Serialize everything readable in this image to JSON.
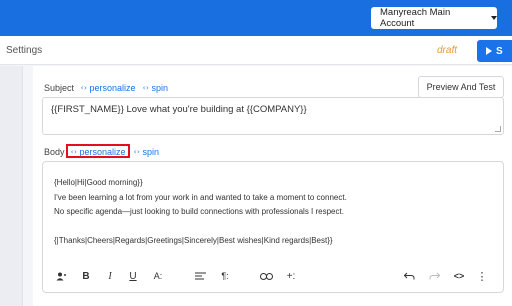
{
  "header": {
    "account_label": "Manyreach Main Account"
  },
  "subheader": {
    "title": "Settings",
    "status": "draft",
    "start_label": "S"
  },
  "subject": {
    "label": "Subject",
    "personalize_label": "personalize",
    "spin_label": "spin",
    "value": "{{FIRST_NAME}} Love what you're building at {{COMPANY}}"
  },
  "preview_button_label": "Preview And Test",
  "body": {
    "label": "Body",
    "personalize_label": "personalize",
    "spin_label": "spin",
    "lines": [
      "{Hello|Hi|Good morning}}",
      "I've been learning a lot from your work in  and wanted to take a moment to connect.",
      "No specific agenda—just looking to build connections with professionals I respect.",
      "",
      "{|Thanks|Cheers|Regards|Greetings|Sincerely|Best wishes|Kind regards|Best}}"
    ]
  },
  "toolbar": {
    "bold": "B",
    "italic": "I",
    "underline": "U",
    "text_size": "A:",
    "paragraph": "¶:",
    "insert": "+:",
    "code": "<>",
    "more": "⋮",
    "icons": [
      "user-icon",
      "bold-icon",
      "italic-icon",
      "underline-icon",
      "font-size-icon",
      "align-icon",
      "paragraph-icon",
      "link-icon",
      "insert-icon",
      "undo-icon",
      "redo-icon",
      "code-icon",
      "more-icon"
    ]
  },
  "colors": {
    "topbar": "#1a6fe0",
    "link": "#1a73e8",
    "draft": "#e29a3b",
    "highlight": "#e2101e"
  }
}
